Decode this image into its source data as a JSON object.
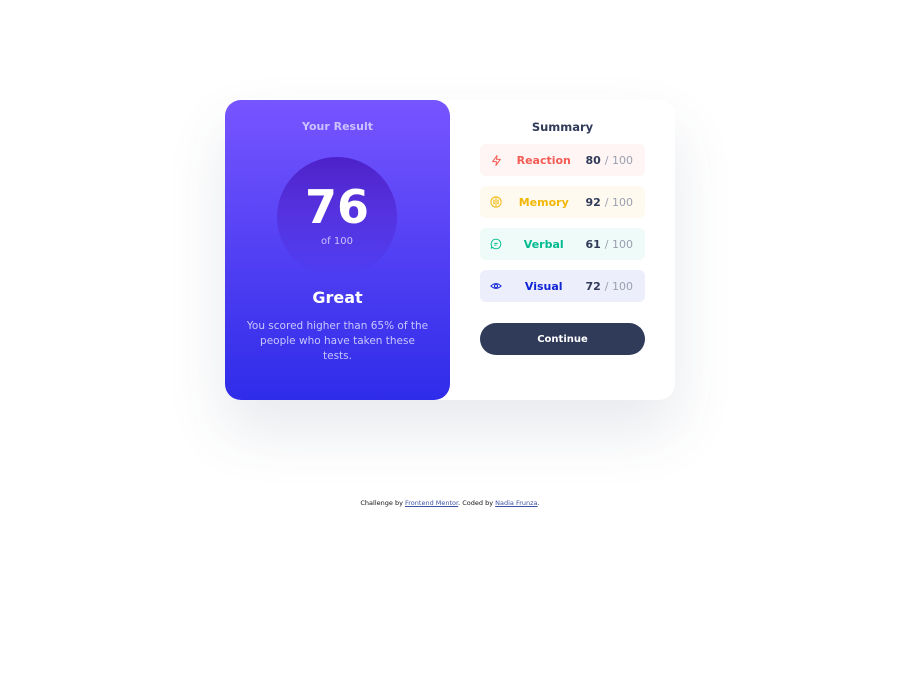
{
  "result": {
    "title": "Your Result",
    "score": "76",
    "score_of": "of 100",
    "heading": "Great",
    "description": "You scored higher than 65% of the people who have taken these tests."
  },
  "summary": {
    "title": "Summary",
    "items": [
      {
        "label": "Reaction",
        "value": "80",
        "max": "/ 100",
        "icon": "lightning-icon",
        "color": "#f25c54",
        "bg": "#fff5f4"
      },
      {
        "label": "Memory",
        "value": "92",
        "max": "/ 100",
        "icon": "brain-icon",
        "color": "#f2b705",
        "bg": "#fffaf0"
      },
      {
        "label": "Verbal",
        "value": "61",
        "max": "/ 100",
        "icon": "speech-bubble-icon",
        "color": "#00bb8f",
        "bg": "#eefbf8"
      },
      {
        "label": "Visual",
        "value": "72",
        "max": "/ 100",
        "icon": "eye-icon",
        "color": "#1125d6",
        "bg": "#eceefb"
      }
    ]
  },
  "continue_label": "Continue",
  "attribution": {
    "prefix": "Challenge by",
    "link1": "Frontend Mentor",
    "middle": ". Coded by",
    "link2": "Nadia Frunza",
    "suffix": "."
  },
  "colors": {
    "gradient_top": "#7755ff",
    "gradient_bottom": "#2f2ce9",
    "dark_blue": "#303b5a"
  }
}
